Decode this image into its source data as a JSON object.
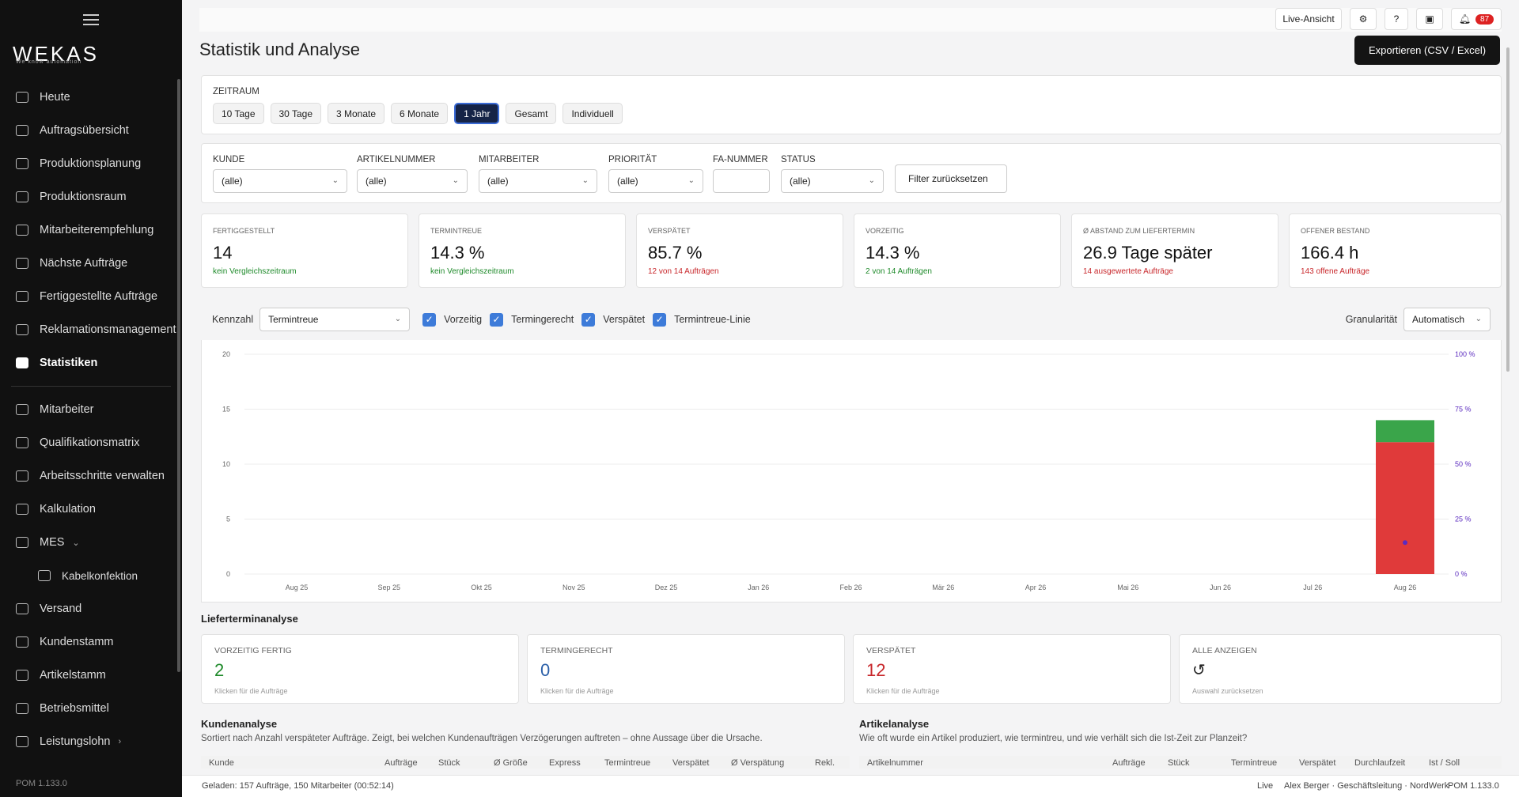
{
  "sidebar": {
    "logo": "WEKAS",
    "logo_sub": "We know automation",
    "items": [
      {
        "label": "Heute"
      },
      {
        "label": "Auftragsübersicht"
      },
      {
        "label": "Produktionsplanung"
      },
      {
        "label": "Produktionsraum"
      },
      {
        "label": "Mitarbeiterempfehlung"
      },
      {
        "label": "Nächste Aufträge"
      },
      {
        "label": "Fertiggestellte Aufträge"
      },
      {
        "label": "Reklamationsmanagement"
      },
      {
        "label": "Statistiken"
      },
      {
        "label": "Mitarbeiter"
      },
      {
        "label": "Qualifikationsmatrix"
      },
      {
        "label": "Arbeitsschritte verwalten"
      },
      {
        "label": "Kalkulation"
      },
      {
        "label": "MES"
      },
      {
        "label": "Kabelkonfektion"
      },
      {
        "label": "Versand"
      },
      {
        "label": "Kundenstamm"
      },
      {
        "label": "Artikelstamm"
      },
      {
        "label": "Betriebsmittel"
      },
      {
        "label": "Leistungslohn"
      }
    ],
    "version": "POM 1.133.0"
  },
  "topbar": {
    "live": "Live-Ansicht",
    "help": "?",
    "notifications": "87"
  },
  "page": {
    "title": "Statistik und Analyse",
    "export": "Exportieren (CSV / Excel)"
  },
  "range": {
    "label": "ZEITRAUM",
    "options": [
      "10 Tage",
      "30 Tage",
      "3 Monate",
      "6 Monate",
      "1 Jahr",
      "Gesamt",
      "Individuell"
    ],
    "selected": "1 Jahr"
  },
  "filters": {
    "kunde": {
      "label": "KUNDE",
      "value": "(alle)"
    },
    "artikel": {
      "label": "ARTIKELNUMMER",
      "value": "(alle)"
    },
    "mitarbeiter": {
      "label": "MITARBEITER",
      "value": "(alle)"
    },
    "prioritaet": {
      "label": "PRIORITÄT",
      "value": "(alle)"
    },
    "fa": {
      "label": "FA-NUMMER",
      "value": ""
    },
    "status": {
      "label": "STATUS",
      "value": "(alle)"
    },
    "reset": "Filter zurücksetzen"
  },
  "kpis": [
    {
      "label": "FERTIGGESTELLT",
      "value": "14",
      "sub": "kein Vergleichszeitraum",
      "sub_color": "green"
    },
    {
      "label": "TERMINTREUE",
      "value": "14.3 %",
      "sub": "kein Vergleichszeitraum",
      "sub_color": "green"
    },
    {
      "label": "VERSPÄTET",
      "value": "85.7 %",
      "sub": "12 von 14 Aufträgen",
      "sub_color": "red",
      "value_color": "red"
    },
    {
      "label": "VORZEITIG",
      "value": "14.3 %",
      "sub": "2 von 14 Aufträgen",
      "sub_color": "green"
    },
    {
      "label": "Ø ABSTAND ZUM LIEFERTERMIN",
      "value": "26.9 Tage später",
      "sub": "14 ausgewertete Aufträge",
      "sub_color": "red"
    },
    {
      "label": "OFFENER BESTAND",
      "value": "166.4 h",
      "sub": "143 offene Aufträge",
      "sub_color": "red"
    }
  ],
  "controls": {
    "kennzahl_label": "Kennzahl",
    "kennzahl_value": "Termintreue",
    "checks": [
      "Vorzeitig",
      "Termingerecht",
      "Verspätet",
      "Termintreue-Linie"
    ],
    "granularity_label": "Granularität",
    "granularity_value": "Automatisch"
  },
  "chart_data": {
    "type": "bar",
    "stacked": true,
    "categories": [
      "Aug 25",
      "Sep 25",
      "Okt 25",
      "Nov 25",
      "Dez 25",
      "Jan 26",
      "Feb 26",
      "Mär 26",
      "Apr 26",
      "Mai 26",
      "Jun 26",
      "Jul 26",
      "Aug 26"
    ],
    "series": [
      {
        "name": "Verspätet",
        "color": "#e03a3a",
        "values": [
          0,
          0,
          0,
          0,
          0,
          0,
          0,
          0,
          0,
          0,
          0,
          0,
          12
        ]
      },
      {
        "name": "Vorzeitig",
        "color": "#3aa54a",
        "values": [
          0,
          0,
          0,
          0,
          0,
          0,
          0,
          0,
          0,
          0,
          0,
          0,
          2
        ]
      },
      {
        "name": "Termintreue-Linie",
        "color": "#5b2bbf",
        "values": [
          null,
          null,
          null,
          null,
          null,
          null,
          null,
          null,
          null,
          null,
          null,
          null,
          14.3
        ]
      }
    ],
    "yticks": [
      "0",
      "5",
      "10",
      "15",
      "20"
    ],
    "ylim": [
      0,
      20
    ],
    "y2ticks": [
      "0 %",
      "25 %",
      "50 %",
      "75 %",
      "100 %"
    ],
    "y2lim": [
      0,
      100
    ],
    "grid": true
  },
  "delivery": {
    "title": "Lieferterminanalyse",
    "cards": [
      {
        "label": "VORZEITIG FERTIG",
        "value": "2",
        "sub": "Klicken für die Aufträge",
        "color": "green"
      },
      {
        "label": "TERMINGERECHT",
        "value": "0",
        "sub": "Klicken für die Aufträge",
        "color": "blue"
      },
      {
        "label": "VERSPÄTET",
        "value": "12",
        "sub": "Klicken für die Aufträge",
        "color": "red"
      },
      {
        "label": "ALLE ANZEIGEN",
        "value": "↺",
        "sub": "Auswahl zurücksetzen",
        "color": "dark"
      }
    ]
  },
  "customer": {
    "title": "Kundenanalyse",
    "desc": "Sortiert nach Anzahl verspäteter Aufträge. Zeigt, bei welchen Kundenaufträgen Verzögerungen auftreten – ohne Aussage über die Ursache.",
    "columns": [
      "Kunde",
      "Aufträge",
      "Stück",
      "Ø Größe",
      "Express",
      "Termintreue",
      "Verspätet",
      "Ø Verspätung",
      "Rekl."
    ]
  },
  "article": {
    "title": "Artikelanalyse",
    "desc": "Wie oft wurde ein Artikel produziert, wie termintreu, und wie verhält sich die Ist-Zeit zur Planzeit?",
    "columns": [
      "Artikelnummer",
      "Aufträge",
      "Stück",
      "Termintreue",
      "Verspätet",
      "Durchlaufzeit",
      "Ist / Soll"
    ]
  },
  "statusbar": {
    "loaded": "Geladen: 157 Aufträge, 150 Mitarbeiter (00:52:14)",
    "live": "Live",
    "user": "Alex Berger · Geschäftsleitung · NordWerk",
    "version": "POM 1.133.0"
  }
}
